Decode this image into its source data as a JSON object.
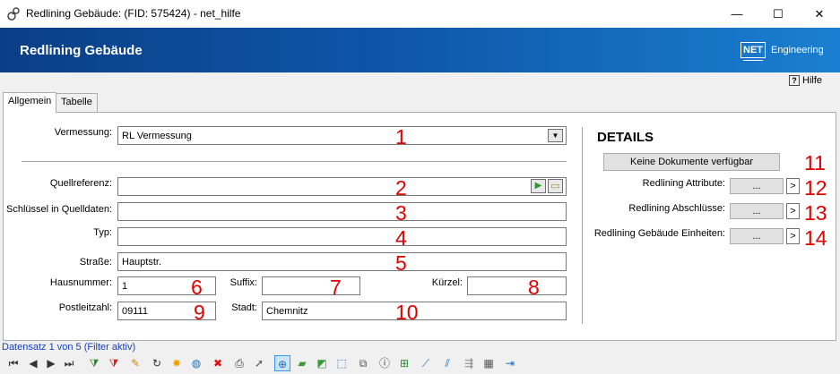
{
  "window": {
    "title": "Redlining Gebäude: (FID: 575424) - net_hilfe",
    "minimize_glyph": "—",
    "maximize_glyph": "☐",
    "close_glyph": "✕"
  },
  "banner": {
    "title": "Redlining Gebäude",
    "logo_box": "NET",
    "logo_text": "Engineering"
  },
  "help": {
    "label": "Hilfe",
    "icon": "question-icon",
    "glyph": "?"
  },
  "tabs": [
    {
      "label": "Allgemein",
      "active": true
    },
    {
      "label": "Tabelle",
      "active": false
    }
  ],
  "form": {
    "vermessung": {
      "label": "Vermessung:",
      "value": "RL Vermessung",
      "marker": "1"
    },
    "quellreferenz": {
      "label": "Quellreferenz:",
      "value": "",
      "marker": "2"
    },
    "schluessel": {
      "label": "Schlüssel in Quelldaten:",
      "value": "",
      "marker": "3"
    },
    "typ": {
      "label": "Typ:",
      "value": "",
      "marker": "4"
    },
    "strasse": {
      "label": "Straße:",
      "value": "Hauptstr.",
      "marker": "5"
    },
    "hausnummer": {
      "label": "Hausnummer:",
      "value": "1",
      "marker": "6"
    },
    "suffix": {
      "label": "Suffix:",
      "value": "",
      "marker": "7"
    },
    "kuerzel": {
      "label": "Kürzel:",
      "value": "",
      "marker": "8"
    },
    "plz": {
      "label": "Postleitzahl:",
      "value": "09111",
      "marker": "9"
    },
    "stadt": {
      "label": "Stadt:",
      "value": "Chemnitz",
      "marker": "10"
    }
  },
  "details": {
    "heading": "DETAILS",
    "documents_button": "Keine Dokumente verfügbar",
    "documents_marker": "11",
    "rows": [
      {
        "label": "Redlining Attribute:",
        "button": "...",
        "arrow": ">",
        "marker": "12"
      },
      {
        "label": "Redlining Abschlüsse:",
        "button": "...",
        "arrow": ">",
        "marker": "13"
      },
      {
        "label": "Redlining Gebäude Einheiten:",
        "button": "...",
        "arrow": ">",
        "marker": "14"
      }
    ]
  },
  "status": {
    "text": "Datensatz 1 von 5 (Filter aktiv)"
  },
  "toolbar": {
    "icons": [
      {
        "name": "first-record-icon",
        "glyph": "⏮",
        "color": "#333333"
      },
      {
        "name": "previous-record-icon",
        "glyph": "◀",
        "color": "#333333"
      },
      {
        "name": "next-record-icon",
        "glyph": "▶",
        "color": "#333333"
      },
      {
        "name": "last-record-icon",
        "glyph": "⏭",
        "color": "#333333"
      },
      {
        "name": "filter-add-icon",
        "glyph": "⧩",
        "color": "#2a8a2a"
      },
      {
        "name": "filter-remove-icon",
        "glyph": "⧩",
        "color": "#cc2222"
      },
      {
        "name": "edit-pencil-icon",
        "glyph": "✎",
        "color": "#d08a10"
      },
      {
        "name": "refresh-icon",
        "glyph": "↻",
        "color": "#333333"
      },
      {
        "name": "new-record-icon",
        "glyph": "✸",
        "color": "#f0a000"
      },
      {
        "name": "globe-icon",
        "glyph": "◍",
        "color": "#1a70c0"
      },
      {
        "name": "delete-icon",
        "glyph": "✖",
        "color": "#dd1111"
      },
      {
        "name": "print-icon",
        "glyph": "⎙",
        "color": "#333333"
      },
      {
        "name": "select-cursor-icon",
        "glyph": "➚",
        "color": "#555555"
      },
      {
        "name": "zoom-icon",
        "glyph": "⊕",
        "color": "#1a70c0"
      },
      {
        "name": "polygon-icon",
        "glyph": "▰",
        "color": "#3a9a3a"
      },
      {
        "name": "polygon-merge-icon",
        "glyph": "◩",
        "color": "#3a9a3a"
      },
      {
        "name": "polygon-select-icon",
        "glyph": "⬚",
        "color": "#1a70c0"
      },
      {
        "name": "copy-shape-icon",
        "glyph": "⧉",
        "color": "#555555"
      },
      {
        "name": "info-icon",
        "glyph": "ⓘ",
        "color": "#333333"
      },
      {
        "name": "add-layer-icon",
        "glyph": "⊞",
        "color": "#2a8a2a"
      },
      {
        "name": "line-tool-icon",
        "glyph": "⟋",
        "color": "#1a70c0"
      },
      {
        "name": "line-split-icon",
        "glyph": "⫽",
        "color": "#1a70c0"
      },
      {
        "name": "join-lines-icon",
        "glyph": "⇶",
        "color": "#888888"
      },
      {
        "name": "table-icon",
        "glyph": "▦",
        "color": "#555555"
      },
      {
        "name": "export-icon",
        "glyph": "⇥",
        "color": "#1a70c0"
      }
    ]
  }
}
